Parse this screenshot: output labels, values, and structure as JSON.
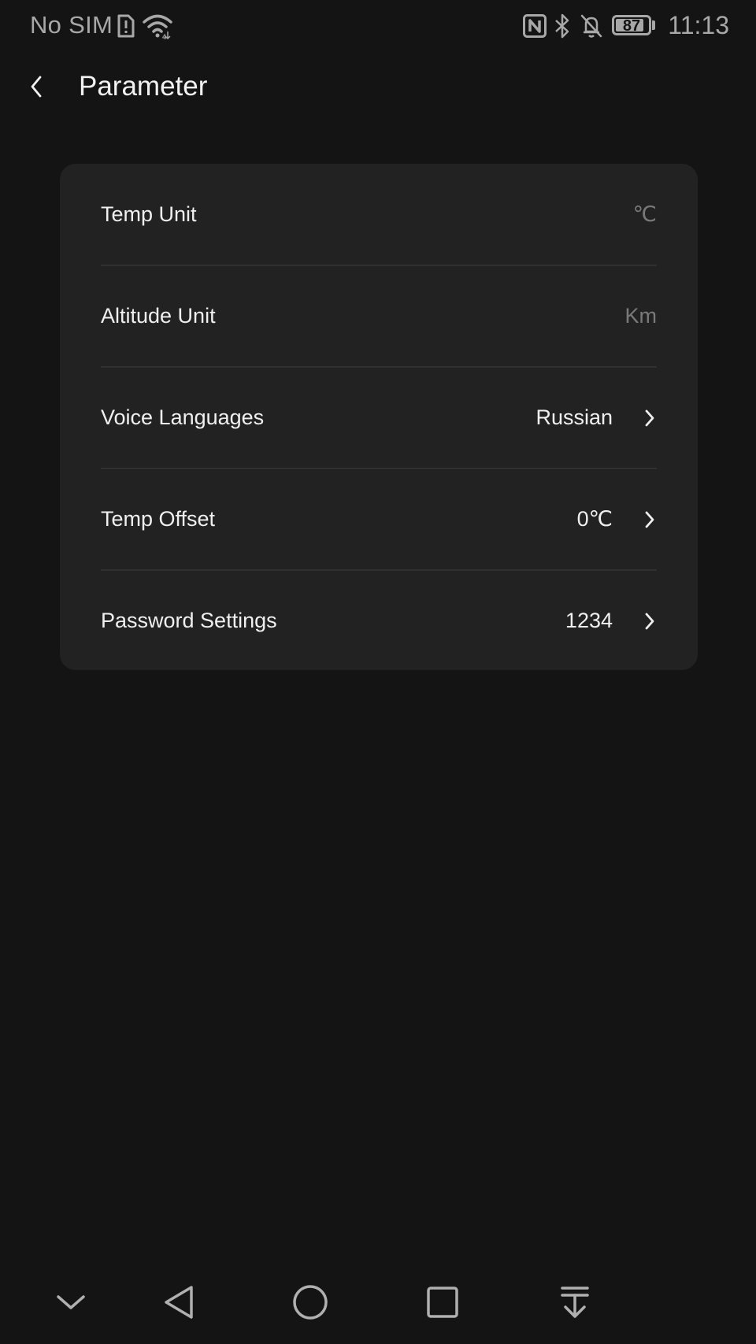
{
  "status_bar": {
    "carrier": "No SIM",
    "battery_level": "87",
    "battery_fraction": 0.87,
    "time": "11:13",
    "icons": [
      "sim-alert-icon",
      "wifi-icon",
      "nfc-icon",
      "bluetooth-icon",
      "bell-muted-icon",
      "battery-icon"
    ]
  },
  "header": {
    "title": "Parameter",
    "back_icon": "chevron-left-icon"
  },
  "settings": {
    "rows": [
      {
        "label": "Temp Unit",
        "value": "℃",
        "has_chevron": false
      },
      {
        "label": "Altitude Unit",
        "value": "Km",
        "has_chevron": false
      },
      {
        "label": "Voice Languages",
        "value": "Russian",
        "has_chevron": true
      },
      {
        "label": "Temp Offset",
        "value": "0℃",
        "has_chevron": true
      },
      {
        "label": "Password Settings",
        "value": "1234",
        "has_chevron": true
      }
    ]
  },
  "nav_bar": {
    "icons": [
      "collapse-down-icon",
      "back-triangle-icon",
      "home-circle-icon",
      "recents-square-icon",
      "download-arrow-icon"
    ]
  },
  "colors": {
    "background": "#141414",
    "card": "#222222",
    "text_primary": "#f0f0f0",
    "text_muted": "#7a7a7a",
    "status_text": "#a8a8a8",
    "divider": "#303030"
  }
}
